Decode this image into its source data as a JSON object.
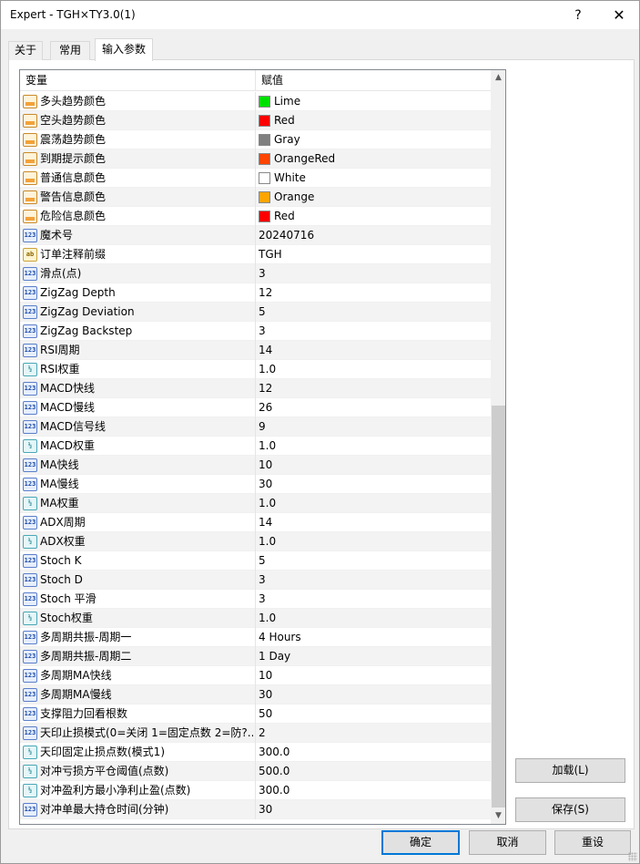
{
  "window": {
    "title": "Expert - TGH×TY3.0(1)",
    "help": "?",
    "close": "✕"
  },
  "tabs": [
    {
      "label": "关于"
    },
    {
      "label": "常用"
    },
    {
      "label": "输入参数"
    }
  ],
  "grid": {
    "headers": {
      "variable": "变量",
      "value": "赋值"
    },
    "rows": [
      {
        "type": "color",
        "name": "多头趋势颜色",
        "value": "Lime",
        "swatch": "#00e000"
      },
      {
        "type": "color",
        "name": "空头趋势颜色",
        "value": "Red",
        "swatch": "#ff0000"
      },
      {
        "type": "color",
        "name": "震荡趋势颜色",
        "value": "Gray",
        "swatch": "#808080"
      },
      {
        "type": "color",
        "name": "到期提示颜色",
        "value": "OrangeRed",
        "swatch": "#ff4500"
      },
      {
        "type": "color",
        "name": "普通信息颜色",
        "value": "White",
        "swatch": "#ffffff"
      },
      {
        "type": "color",
        "name": "警告信息颜色",
        "value": "Orange",
        "swatch": "#ffa500"
      },
      {
        "type": "color",
        "name": "危险信息颜色",
        "value": "Red",
        "swatch": "#ff0000"
      },
      {
        "type": "int",
        "name": "魔术号",
        "value": "20240716"
      },
      {
        "type": "str",
        "name": "订单注释前缀",
        "value": "TGH"
      },
      {
        "type": "int",
        "name": "滑点(点)",
        "value": "3"
      },
      {
        "type": "int",
        "name": "ZigZag Depth",
        "value": "12"
      },
      {
        "type": "int",
        "name": "ZigZag Deviation",
        "value": "5"
      },
      {
        "type": "int",
        "name": "ZigZag Backstep",
        "value": "3"
      },
      {
        "type": "int",
        "name": "RSI周期",
        "value": "14"
      },
      {
        "type": "dbl",
        "name": "RSI权重",
        "value": "1.0"
      },
      {
        "type": "int",
        "name": "MACD快线",
        "value": "12"
      },
      {
        "type": "int",
        "name": "MACD慢线",
        "value": "26"
      },
      {
        "type": "int",
        "name": "MACD信号线",
        "value": "9"
      },
      {
        "type": "dbl",
        "name": "MACD权重",
        "value": "1.0"
      },
      {
        "type": "int",
        "name": "MA快线",
        "value": "10"
      },
      {
        "type": "int",
        "name": "MA慢线",
        "value": "30"
      },
      {
        "type": "dbl",
        "name": "MA权重",
        "value": "1.0"
      },
      {
        "type": "int",
        "name": "ADX周期",
        "value": "14"
      },
      {
        "type": "dbl",
        "name": "ADX权重",
        "value": "1.0"
      },
      {
        "type": "int",
        "name": "Stoch K",
        "value": "5"
      },
      {
        "type": "int",
        "name": "Stoch D",
        "value": "3"
      },
      {
        "type": "int",
        "name": "Stoch 平滑",
        "value": "3"
      },
      {
        "type": "dbl",
        "name": "Stoch权重",
        "value": "1.0"
      },
      {
        "type": "int",
        "name": "多周期共振-周期一",
        "value": "4 Hours"
      },
      {
        "type": "int",
        "name": "多周期共振-周期二",
        "value": "1 Day"
      },
      {
        "type": "int",
        "name": "多周期MA快线",
        "value": "10"
      },
      {
        "type": "int",
        "name": "多周期MA慢线",
        "value": "30"
      },
      {
        "type": "int",
        "name": "支撑阻力回看根数",
        "value": "50"
      },
      {
        "type": "int",
        "name": "天印止损模式(0=关闭 1=固定点数 2=防?..",
        "value": "2"
      },
      {
        "type": "dbl",
        "name": "天印固定止损点数(模式1)",
        "value": "300.0"
      },
      {
        "type": "dbl",
        "name": "对冲亏损方平仓阈值(点数)",
        "value": "500.0"
      },
      {
        "type": "dbl",
        "name": "对冲盈利方最小净利止盈(点数)",
        "value": "300.0"
      },
      {
        "type": "int",
        "name": "对冲单最大持仓时间(分钟)",
        "value": "30"
      }
    ]
  },
  "type_icons": {
    "color": "",
    "int": "123",
    "str": "ab",
    "dbl": "½"
  },
  "buttons": {
    "load": "加载(L)",
    "save": "保存(S)",
    "ok": "确定",
    "cancel": "取消",
    "reset": "重设"
  },
  "colors": {
    "accent": "#0078d7"
  }
}
